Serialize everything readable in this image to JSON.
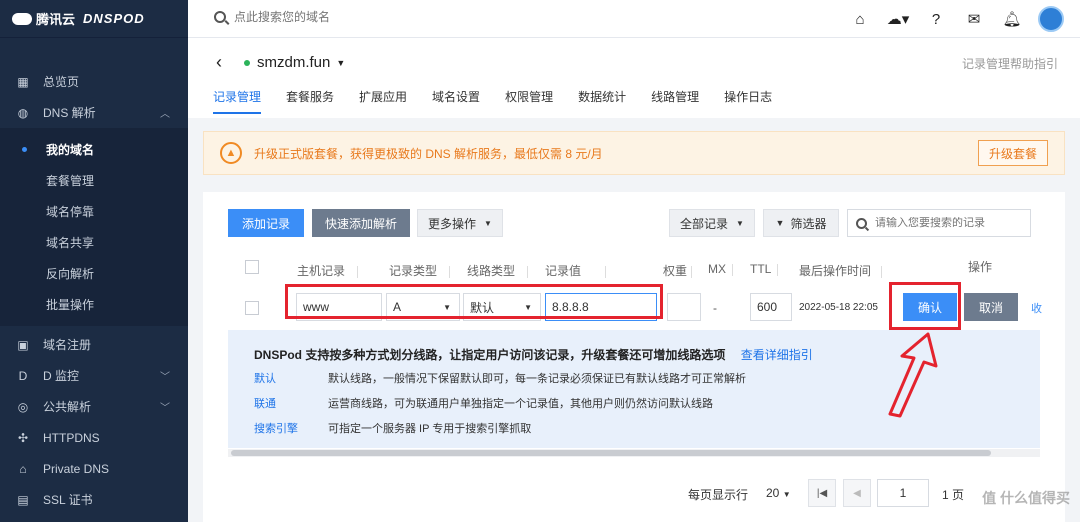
{
  "brand": {
    "name": "腾讯云",
    "product": "DNSPOD"
  },
  "sidebar": {
    "items": [
      {
        "label": "总览页",
        "icon": "grid-icon"
      },
      {
        "label": "DNS 解析",
        "icon": "globe-icon",
        "expanded": true
      }
    ],
    "dns_sub": [
      {
        "label": "我的域名",
        "active": true
      },
      {
        "label": "套餐管理"
      },
      {
        "label": "域名停靠"
      },
      {
        "label": "域名共享"
      },
      {
        "label": "反向解析"
      },
      {
        "label": "批量操作"
      }
    ],
    "bottom_items": [
      {
        "label": "域名注册",
        "icon": "register-icon"
      },
      {
        "label": "D 监控",
        "icon": "monitor-icon",
        "chevron": "down"
      },
      {
        "label": "公共解析",
        "icon": "public-dns-icon",
        "chevron": "down"
      },
      {
        "label": "HTTPDNS",
        "icon": "httpdns-icon"
      },
      {
        "label": "Private DNS",
        "icon": "private-dns-icon"
      },
      {
        "label": "SSL 证书",
        "icon": "ssl-icon"
      }
    ]
  },
  "topbar": {
    "search_placeholder": "点此搜索您的域名"
  },
  "domain": {
    "name": "smzdm.fun",
    "help": "记录管理帮助指引"
  },
  "tabs": [
    "记录管理",
    "套餐服务",
    "扩展应用",
    "域名设置",
    "权限管理",
    "数据统计",
    "线路管理",
    "操作日志"
  ],
  "notice": {
    "text": "升级正式版套餐，获得更极致的 DNS 解析服务，最低仅需 8 元/月",
    "button": "升级套餐"
  },
  "toolbar": {
    "add": "添加记录",
    "quick_add": "快速添加解析",
    "more": "更多操作",
    "all_records": "全部记录",
    "filter": "筛选器",
    "search_placeholder": "请输入您要搜索的记录"
  },
  "table": {
    "headers": [
      "主机记录",
      "记录类型",
      "线路类型",
      "记录值",
      "权重",
      "MX",
      "TTL",
      "最后操作时间",
      "操作"
    ]
  },
  "edit_row": {
    "host": "www",
    "type": "A",
    "line": "默认",
    "value": "8.8.8.8",
    "mx": "-",
    "ttl": "600",
    "time": "2022-05-18 22:05",
    "confirm": "确认",
    "cancel": "取消",
    "extra": "收"
  },
  "info": {
    "title": "DNSPod 支持按多种方式划分线路，让指定用户访问该记录，升级套餐还可增加线路选项",
    "link": "查看详细指引",
    "rows": [
      {
        "key": "默认",
        "desc": "默认线路，一般情况下保留默认即可，每一条记录必须保证已有默认线路才可正常解析"
      },
      {
        "key": "联通",
        "desc": "运营商线路，可为联通用户单独指定一个记录值，其他用户则仍然访问默认线路"
      },
      {
        "key": "搜索引擎",
        "desc": "可指定一个服务器 IP 专用于搜索引擎抓取"
      }
    ]
  },
  "pager": {
    "per_page_label": "每页显示行",
    "per_page": "20",
    "page": "1",
    "total": "1 页"
  },
  "watermark": "值 什么值得买",
  "colors": {
    "accent": "#3b8ef7",
    "sidebar": "#1c2c44",
    "highlight": "#e4232e",
    "notice": "#e8791c"
  }
}
